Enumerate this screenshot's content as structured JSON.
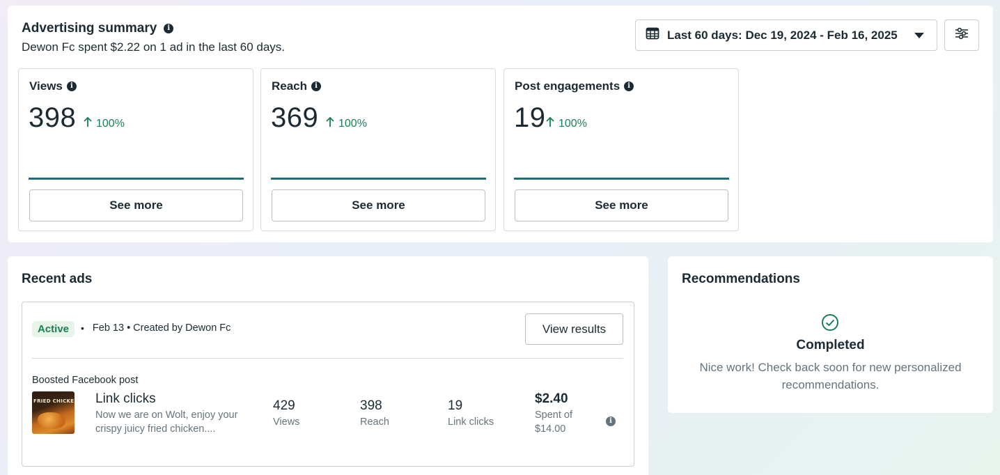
{
  "summary": {
    "title": "Advertising summary",
    "subtitle": "Dewon Fc spent $2.22 on 1 ad in the last 60 days.",
    "date_range": "Last 60 days: Dec 19, 2024 - Feb 16, 2025",
    "metrics": [
      {
        "label": "Views",
        "value": "398",
        "change": "100%",
        "button": "See more"
      },
      {
        "label": "Reach",
        "value": "369",
        "change": "100%",
        "button": "See more"
      },
      {
        "label": "Post engagements",
        "value": "19",
        "change": "100%",
        "button": "See more"
      }
    ]
  },
  "recent_ads": {
    "title": "Recent ads",
    "ad": {
      "status": "Active",
      "meta": "Feb 13 • Created by Dewon Fc",
      "view_button": "View results",
      "type": "Boosted Facebook post",
      "thumbnail_text": "FRIED CHICKEN",
      "headline": "Link clicks",
      "description": "Now we are on Wolt, enjoy your crispy juicy fried chicken....",
      "stats": [
        {
          "value": "429",
          "label": "Views"
        },
        {
          "value": "398",
          "label": "Reach"
        },
        {
          "value": "19",
          "label": "Link clicks"
        },
        {
          "value": "$2.40",
          "label": "Spent of $14.00"
        }
      ]
    }
  },
  "recommendations": {
    "title": "Recommendations",
    "status": "Completed",
    "message": "Nice work! Check back soon for new personalized recommendations."
  },
  "colors": {
    "positive": "#1a7f55",
    "metric_line": "#1b6d78",
    "badge_bg": "#e6f4ea"
  }
}
